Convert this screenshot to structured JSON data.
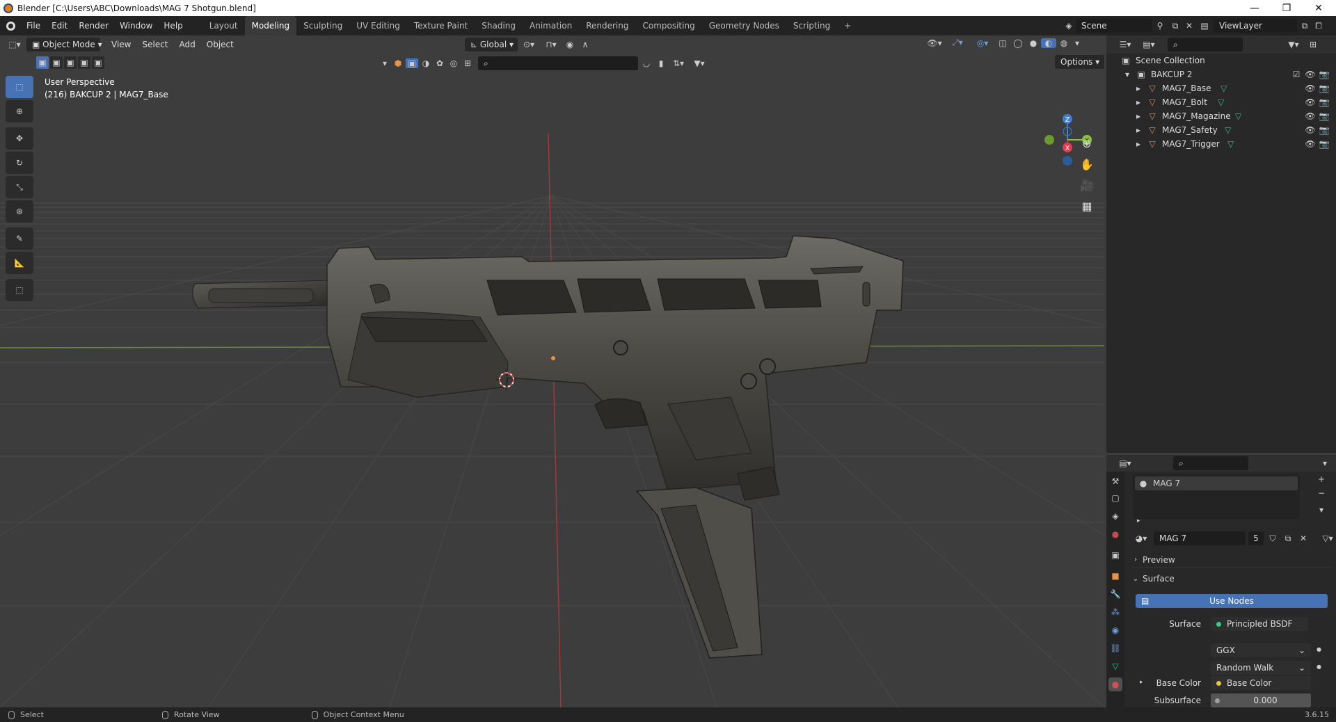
{
  "titlebar": {
    "title": "Blender [C:\\Users\\ABC\\Downloads\\MAG 7 Shotgun.blend]",
    "minimize": "—",
    "restore": "❐",
    "close": "✕"
  },
  "menu": [
    "File",
    "Edit",
    "Render",
    "Window",
    "Help"
  ],
  "workspaces": [
    "Layout",
    "Modeling",
    "Sculpting",
    "UV Editing",
    "Texture Paint",
    "Shading",
    "Animation",
    "Rendering",
    "Compositing",
    "Geometry Nodes",
    "Scripting"
  ],
  "active_workspace": "Modeling",
  "scene": "Scene",
  "viewlayer": "ViewLayer",
  "viewport": {
    "mode": "Object Mode",
    "menus": [
      "View",
      "Select",
      "Add",
      "Object"
    ],
    "transform_orientation": "Global",
    "options": "Options",
    "overlay_line1": "User Perspective",
    "overlay_line2": "(216) BAKCUP 2 | MAG7_Base",
    "gizmo": {
      "z": "Z",
      "y": "Y",
      "x": "X"
    }
  },
  "outliner": {
    "root": "Scene Collection",
    "collection": "BAKCUP 2",
    "objects": [
      "MAG7_Base",
      "MAG7_Bolt",
      "MAG7_Magazine",
      "MAG7_Safety",
      "MAG7_Trigger"
    ]
  },
  "properties": {
    "slot": "MAG 7",
    "material": "MAG 7",
    "users": "5",
    "preview": "Preview",
    "surface_panel": "Surface",
    "use_nodes": "Use Nodes",
    "surface_label": "Surface",
    "surface_value": "Principled BSDF",
    "distribution": "GGX",
    "subsurface_method": "Random Walk",
    "base_color_label": "Base Color",
    "base_color_value": "Base Color",
    "subsurface_label": "Subsurface",
    "subsurface_value": "0.000"
  },
  "status": {
    "select": "Select",
    "rotate": "Rotate View",
    "context": "Object Context Menu",
    "version": "3.6.15"
  },
  "colors": {
    "accent": "#4772b3",
    "x_axis": "#e03c4d",
    "y_axis": "#8bc23f",
    "z_axis": "#3b7fd6",
    "outliner_obj": "#e8924a",
    "mesh_data": "#2ac38e"
  }
}
